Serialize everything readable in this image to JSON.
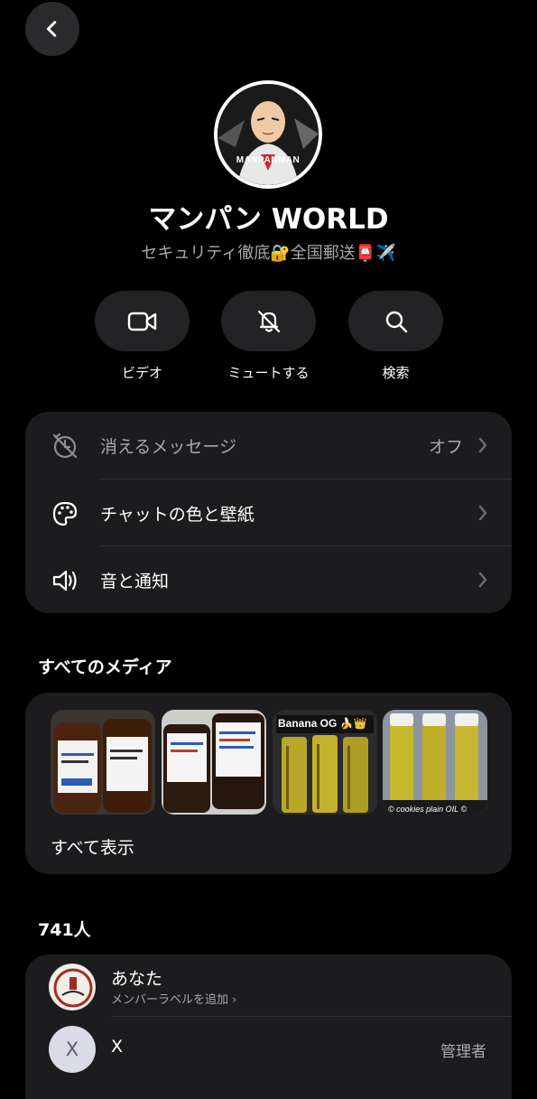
{
  "header": {
    "back_icon": "chevron-left-icon"
  },
  "profile": {
    "avatar_caption": "MANPANMAN",
    "name": "マンパン WORLD",
    "description": "セキュリティ徹底🔐全国郵送📮✈️"
  },
  "actions": [
    {
      "label": "ビデオ",
      "icon": "video-icon"
    },
    {
      "label": "ミュートする",
      "icon": "bell-off-icon"
    },
    {
      "label": "検索",
      "icon": "search-icon"
    }
  ],
  "settings": {
    "disappearing": {
      "label": "消えるメッセージ",
      "value": "オフ",
      "icon": "timer-off-icon"
    },
    "chat_theme": {
      "label": "チャットの色と壁紙",
      "icon": "palette-icon"
    },
    "sound": {
      "label": "音と通知",
      "icon": "speaker-icon"
    }
  },
  "media": {
    "heading": "すべてのメディア",
    "show_all": "すべて表示",
    "thumbs": [
      {
        "caption": ""
      },
      {
        "caption": ""
      },
      {
        "caption": "Banana OG 🍌👑"
      },
      {
        "caption": "© cookies plain OIL ©"
      }
    ]
  },
  "members": {
    "count_label": "741人",
    "list": [
      {
        "name": "あなた",
        "sub": "メンバーラベルを追加 ›",
        "role": ""
      },
      {
        "name": "X",
        "sub": "",
        "role": "管理者",
        "initial": "X"
      }
    ]
  },
  "colors": {
    "background": "#000000",
    "card": "#1c1c1e",
    "secondary_text": "#a8a8ad"
  }
}
